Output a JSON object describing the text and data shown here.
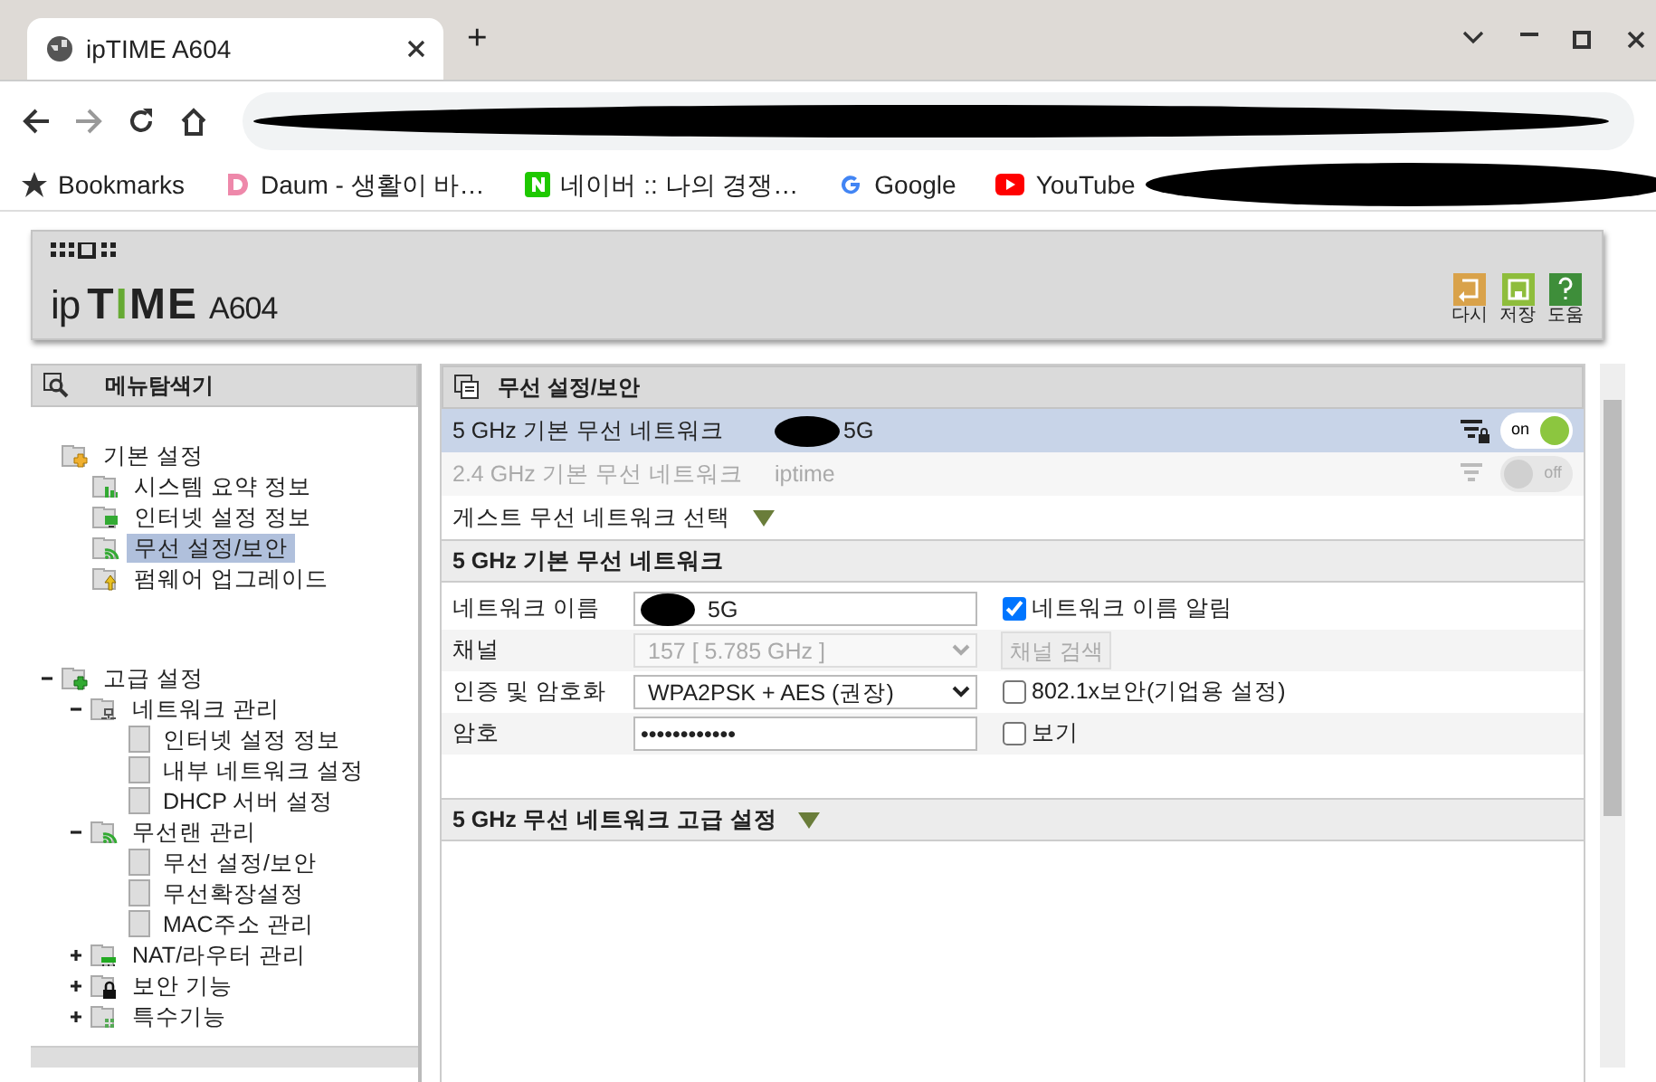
{
  "browser": {
    "tab_title": "ipTIME A604",
    "new_tab": "+",
    "bookmarks": [
      {
        "label": "Bookmarks",
        "kind": "star"
      },
      {
        "label": "Daum - 생활이 바…",
        "kind": "daum"
      },
      {
        "label": "네이버 :: 나의 경쟁…",
        "kind": "naver"
      },
      {
        "label": "Google",
        "kind": "google"
      },
      {
        "label": "YouTube",
        "kind": "youtube"
      }
    ]
  },
  "header": {
    "logo_text": "ipTIME",
    "model": "A604",
    "buttons": [
      {
        "label": "다시",
        "kind": "undo"
      },
      {
        "label": "저장",
        "kind": "save"
      },
      {
        "label": "도움",
        "kind": "help"
      }
    ]
  },
  "menu": {
    "title": "메뉴탐색기",
    "tree": [
      {
        "label": "기본 설정",
        "kind": "basic",
        "children": [
          {
            "label": "시스템 요약 정보",
            "kind": "chart",
            "selected": false
          },
          {
            "label": "인터넷 설정 정보",
            "kind": "monitor",
            "selected": false
          },
          {
            "label": "무선 설정/보안",
            "kind": "wifi",
            "selected": true
          },
          {
            "label": "펌웨어 업그레이드",
            "kind": "upgrade",
            "selected": false
          }
        ]
      },
      {
        "label": "고급 설정",
        "kind": "advanced",
        "expanded": true,
        "children": [
          {
            "label": "네트워크 관리",
            "kind": "network",
            "expanded": true,
            "children": [
              {
                "label": "인터넷 설정 정보",
                "kind": "page",
                "selected": false
              },
              {
                "label": "내부 네트워크 설정",
                "kind": "page",
                "selected": false
              },
              {
                "label": "DHCP 서버 설정",
                "kind": "page",
                "selected": false
              }
            ]
          },
          {
            "label": "무선랜 관리",
            "kind": "wifi",
            "expanded": true,
            "children": [
              {
                "label": "무선 설정/보안",
                "kind": "page",
                "selected": false
              },
              {
                "label": "무선확장설정",
                "kind": "page",
                "selected": false
              },
              {
                "label": "MAC주소 관리",
                "kind": "page",
                "selected": false
              }
            ]
          },
          {
            "label": "NAT/라우터 관리",
            "kind": "router",
            "expanded": false
          },
          {
            "label": "보안 기능",
            "kind": "lock",
            "expanded": false
          },
          {
            "label": "특수기능",
            "kind": "special",
            "expanded": false
          }
        ]
      }
    ]
  },
  "content": {
    "title": "무선 설정/보안",
    "networks": [
      {
        "label": "5 GHz 기본 무선 네트워크",
        "ssid": "5G",
        "locked": true,
        "on": true,
        "toggle_text": "on",
        "selected": true
      },
      {
        "label": "2.4 GHz 기본 무선 네트워크",
        "ssid": "iptime",
        "locked": false,
        "on": false,
        "toggle_text": "off",
        "selected": false
      }
    ],
    "guest": {
      "label": "게스트 무선 네트워크 선택",
      "expanded": false
    },
    "section_title": "5 GHz 기본 무선 네트워크",
    "fields": [
      {
        "label": "네트워크 이름",
        "kind": "text",
        "value": "5G",
        "option": {
          "label": "네트워크 이름 알림",
          "checked": true
        }
      },
      {
        "label": "채널",
        "kind": "select",
        "value": "157 [ 5.785 GHz ]",
        "disabled": true,
        "button": "채널 검색"
      },
      {
        "label": "인증 및 암호화",
        "kind": "select",
        "value": "WPA2PSK + AES (권장)",
        "disabled": false,
        "option": {
          "label": "802.1x보안(기업용 설정)",
          "checked": false
        }
      },
      {
        "label": "암호",
        "kind": "password",
        "value": "••••••••••••",
        "option": {
          "label": "보기",
          "checked": false
        }
      }
    ],
    "advanced": {
      "label": "5 GHz 무선 네트워크 고급 설정",
      "expanded": false
    }
  }
}
